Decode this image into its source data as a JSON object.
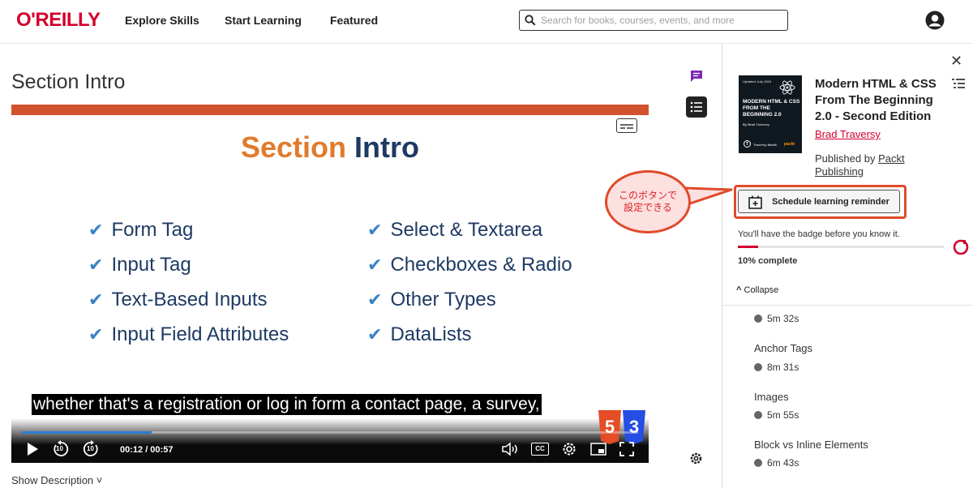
{
  "header": {
    "logo": "O'REILLY",
    "nav": [
      "Explore Skills",
      "Start Learning",
      "Featured"
    ],
    "search_placeholder": "Search for books, courses, events, and more"
  },
  "main": {
    "title": "Section Intro",
    "slide": {
      "title_part1": "Section",
      "title_part2": "Intro",
      "left_items": [
        "Form Tag",
        "Input Tag",
        "Text-Based Inputs",
        "Input Field Attributes"
      ],
      "right_items": [
        "Select & Textarea",
        "Checkboxes & Radio",
        "Other Types",
        "DataLists"
      ]
    },
    "caption": "whether that's a registration or log in form a contact page, a survey,",
    "player": {
      "time": "00:12 / 00:57",
      "progress": 0.21,
      "skip": "10",
      "cc_label": "CC",
      "colors": {
        "progress": "#2d7fd3"
      }
    },
    "show_description": "Show Description"
  },
  "sidebar": {
    "book_title": "Modern HTML & CSS From The Beginning 2.0 - Second Edition",
    "author": "Brad Traversy",
    "published_prefix": "Published by ",
    "publisher_line1": "Packt",
    "publisher_line2": "Publishing",
    "cover": {
      "updated": "Updated July 2024",
      "title": "MODERN HTML & CSS FROM THE BEGINNING 2.0",
      "author": "By Brad Traversy",
      "brand": "Traversy Media",
      "publisher": "packt"
    },
    "schedule_label": "Schedule learning reminder",
    "badge_text": "You'll have the badge before you know it.",
    "progress": 0.1,
    "percent_label": "10% complete",
    "collapse_label": "Collapse",
    "lessons": [
      {
        "title": "",
        "duration": "5m 32s"
      },
      {
        "title": "Anchor Tags",
        "duration": "8m 31s"
      },
      {
        "title": "Images",
        "duration": "5m 55s"
      },
      {
        "title": "Block vs Inline Elements",
        "duration": "6m 43s"
      }
    ]
  },
  "annotation": {
    "line1": "このボタンで",
    "line2": "設定できる"
  },
  "colors": {
    "brand": "#d3002d",
    "accent": "#e04a2a",
    "slide_orange": "#e07b2c",
    "slide_navy": "#1d3a63"
  }
}
